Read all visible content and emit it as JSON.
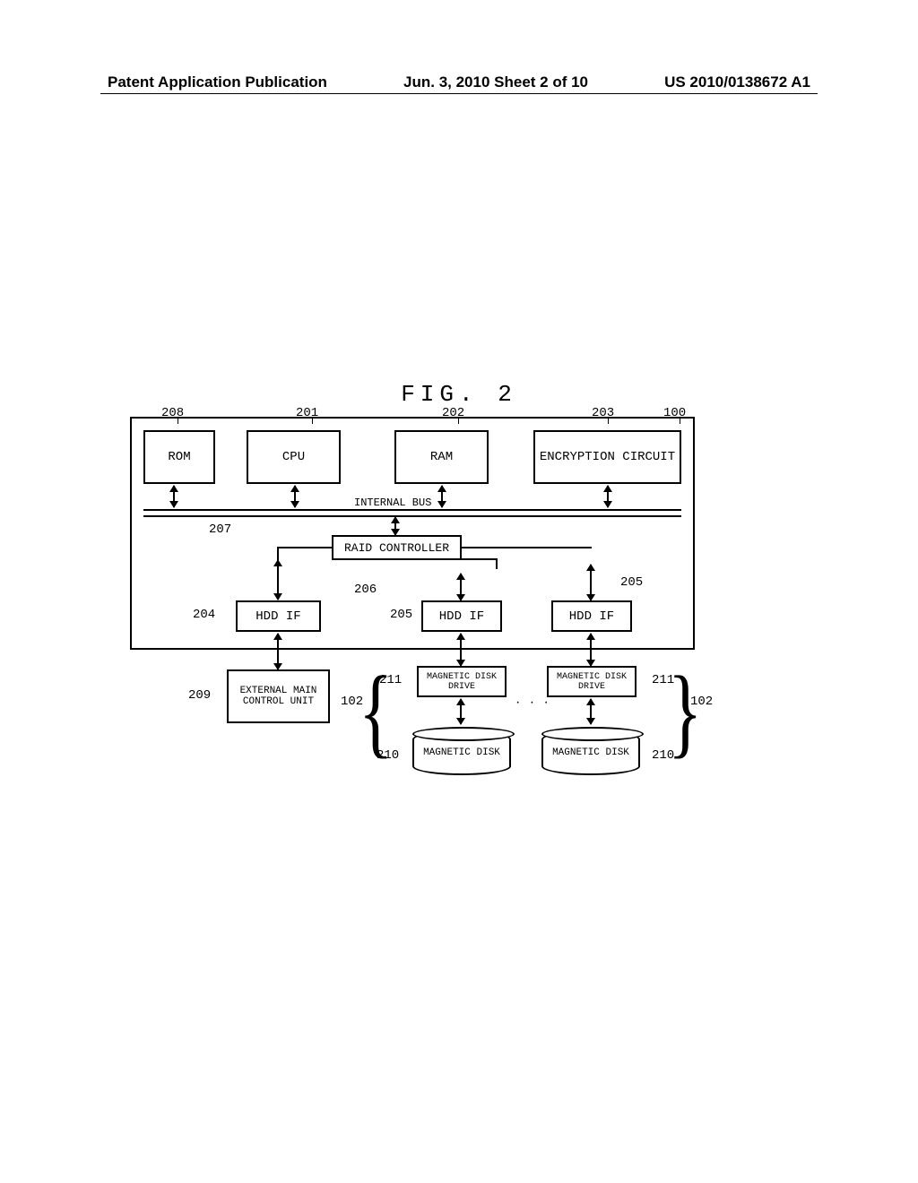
{
  "header": {
    "left": "Patent Application Publication",
    "center": "Jun. 3, 2010  Sheet 2 of 10",
    "right": "US 2010/0138672 A1"
  },
  "figure_title": "FIG. 2",
  "blocks": {
    "rom": "ROM",
    "cpu": "CPU",
    "ram": "RAM",
    "enc": "ENCRYPTION CIRCUIT",
    "bus": "INTERNAL BUS",
    "raid": "RAID CONTROLLER",
    "hdd1": "HDD IF",
    "hdd2": "HDD IF",
    "hdd3": "HDD IF",
    "ext": "EXTERNAL MAIN\nCONTROL UNIT",
    "mdd1": "MAGNETIC DISK\nDRIVE",
    "mdd2": "MAGNETIC DISK\nDRIVE",
    "disk1": "MAGNETIC DISK",
    "disk2": "MAGNETIC DISK"
  },
  "refs": {
    "r208": "208",
    "r201": "201",
    "r202": "202",
    "r203": "203",
    "r100": "100",
    "r207": "207",
    "r206": "206",
    "r204": "204",
    "r205a": "205",
    "r205b": "205",
    "r209": "209",
    "r211a": "211",
    "r211b": "211",
    "r102a": "102",
    "r102b": "102",
    "r210a": "210",
    "r210b": "210"
  },
  "dots": "· · ·"
}
